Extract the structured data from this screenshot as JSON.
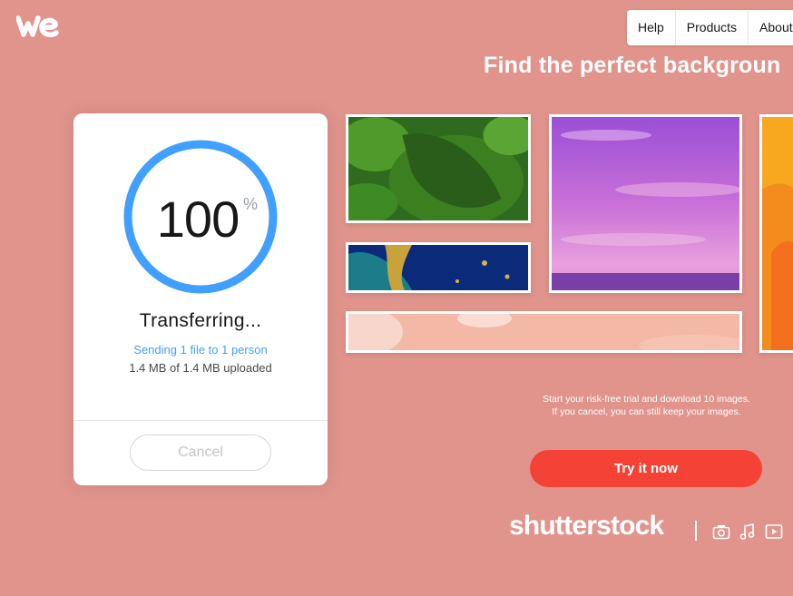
{
  "header": {
    "logo_icon": "wetransfer-logo",
    "nav": [
      {
        "label": "Help"
      },
      {
        "label": "Products"
      },
      {
        "label": "About"
      }
    ]
  },
  "transfer": {
    "progress_percent": 100,
    "percent_value": "100",
    "percent_sign": "%",
    "status": "Transferring...",
    "recipients": "Sending 1 file to 1 person",
    "uploaded": "1.4 MB of 1.4 MB uploaded",
    "cancel_label": "Cancel"
  },
  "ad": {
    "headline": "Find the perfect backgroun",
    "promo_line1": "Start your risk-free trial and download 10 images.",
    "promo_line2": "If you cancel, you can still keep your images.",
    "cta_label": "Try it now",
    "brand": "shutterstock",
    "media_icons": [
      "camera-icon",
      "music-icon",
      "video-icon"
    ]
  },
  "colors": {
    "background": "#e0948c",
    "progress_ring": "#409fff",
    "cta": "#f44336",
    "link": "#409fff"
  }
}
